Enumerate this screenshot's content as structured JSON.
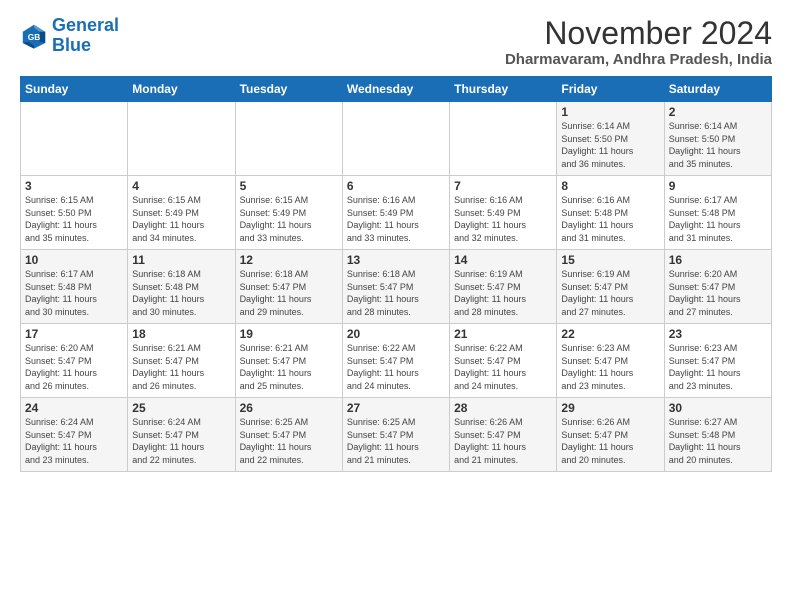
{
  "logo": {
    "line1": "General",
    "line2": "Blue"
  },
  "title": "November 2024",
  "location": "Dharmavaram, Andhra Pradesh, India",
  "days_header": [
    "Sunday",
    "Monday",
    "Tuesday",
    "Wednesday",
    "Thursday",
    "Friday",
    "Saturday"
  ],
  "weeks": [
    [
      {
        "num": "",
        "detail": ""
      },
      {
        "num": "",
        "detail": ""
      },
      {
        "num": "",
        "detail": ""
      },
      {
        "num": "",
        "detail": ""
      },
      {
        "num": "",
        "detail": ""
      },
      {
        "num": "1",
        "detail": "Sunrise: 6:14 AM\nSunset: 5:50 PM\nDaylight: 11 hours\nand 36 minutes."
      },
      {
        "num": "2",
        "detail": "Sunrise: 6:14 AM\nSunset: 5:50 PM\nDaylight: 11 hours\nand 35 minutes."
      }
    ],
    [
      {
        "num": "3",
        "detail": "Sunrise: 6:15 AM\nSunset: 5:50 PM\nDaylight: 11 hours\nand 35 minutes."
      },
      {
        "num": "4",
        "detail": "Sunrise: 6:15 AM\nSunset: 5:49 PM\nDaylight: 11 hours\nand 34 minutes."
      },
      {
        "num": "5",
        "detail": "Sunrise: 6:15 AM\nSunset: 5:49 PM\nDaylight: 11 hours\nand 33 minutes."
      },
      {
        "num": "6",
        "detail": "Sunrise: 6:16 AM\nSunset: 5:49 PM\nDaylight: 11 hours\nand 33 minutes."
      },
      {
        "num": "7",
        "detail": "Sunrise: 6:16 AM\nSunset: 5:49 PM\nDaylight: 11 hours\nand 32 minutes."
      },
      {
        "num": "8",
        "detail": "Sunrise: 6:16 AM\nSunset: 5:48 PM\nDaylight: 11 hours\nand 31 minutes."
      },
      {
        "num": "9",
        "detail": "Sunrise: 6:17 AM\nSunset: 5:48 PM\nDaylight: 11 hours\nand 31 minutes."
      }
    ],
    [
      {
        "num": "10",
        "detail": "Sunrise: 6:17 AM\nSunset: 5:48 PM\nDaylight: 11 hours\nand 30 minutes."
      },
      {
        "num": "11",
        "detail": "Sunrise: 6:18 AM\nSunset: 5:48 PM\nDaylight: 11 hours\nand 30 minutes."
      },
      {
        "num": "12",
        "detail": "Sunrise: 6:18 AM\nSunset: 5:47 PM\nDaylight: 11 hours\nand 29 minutes."
      },
      {
        "num": "13",
        "detail": "Sunrise: 6:18 AM\nSunset: 5:47 PM\nDaylight: 11 hours\nand 28 minutes."
      },
      {
        "num": "14",
        "detail": "Sunrise: 6:19 AM\nSunset: 5:47 PM\nDaylight: 11 hours\nand 28 minutes."
      },
      {
        "num": "15",
        "detail": "Sunrise: 6:19 AM\nSunset: 5:47 PM\nDaylight: 11 hours\nand 27 minutes."
      },
      {
        "num": "16",
        "detail": "Sunrise: 6:20 AM\nSunset: 5:47 PM\nDaylight: 11 hours\nand 27 minutes."
      }
    ],
    [
      {
        "num": "17",
        "detail": "Sunrise: 6:20 AM\nSunset: 5:47 PM\nDaylight: 11 hours\nand 26 minutes."
      },
      {
        "num": "18",
        "detail": "Sunrise: 6:21 AM\nSunset: 5:47 PM\nDaylight: 11 hours\nand 26 minutes."
      },
      {
        "num": "19",
        "detail": "Sunrise: 6:21 AM\nSunset: 5:47 PM\nDaylight: 11 hours\nand 25 minutes."
      },
      {
        "num": "20",
        "detail": "Sunrise: 6:22 AM\nSunset: 5:47 PM\nDaylight: 11 hours\nand 24 minutes."
      },
      {
        "num": "21",
        "detail": "Sunrise: 6:22 AM\nSunset: 5:47 PM\nDaylight: 11 hours\nand 24 minutes."
      },
      {
        "num": "22",
        "detail": "Sunrise: 6:23 AM\nSunset: 5:47 PM\nDaylight: 11 hours\nand 23 minutes."
      },
      {
        "num": "23",
        "detail": "Sunrise: 6:23 AM\nSunset: 5:47 PM\nDaylight: 11 hours\nand 23 minutes."
      }
    ],
    [
      {
        "num": "24",
        "detail": "Sunrise: 6:24 AM\nSunset: 5:47 PM\nDaylight: 11 hours\nand 23 minutes."
      },
      {
        "num": "25",
        "detail": "Sunrise: 6:24 AM\nSunset: 5:47 PM\nDaylight: 11 hours\nand 22 minutes."
      },
      {
        "num": "26",
        "detail": "Sunrise: 6:25 AM\nSunset: 5:47 PM\nDaylight: 11 hours\nand 22 minutes."
      },
      {
        "num": "27",
        "detail": "Sunrise: 6:25 AM\nSunset: 5:47 PM\nDaylight: 11 hours\nand 21 minutes."
      },
      {
        "num": "28",
        "detail": "Sunrise: 6:26 AM\nSunset: 5:47 PM\nDaylight: 11 hours\nand 21 minutes."
      },
      {
        "num": "29",
        "detail": "Sunrise: 6:26 AM\nSunset: 5:47 PM\nDaylight: 11 hours\nand 20 minutes."
      },
      {
        "num": "30",
        "detail": "Sunrise: 6:27 AM\nSunset: 5:48 PM\nDaylight: 11 hours\nand 20 minutes."
      }
    ]
  ]
}
